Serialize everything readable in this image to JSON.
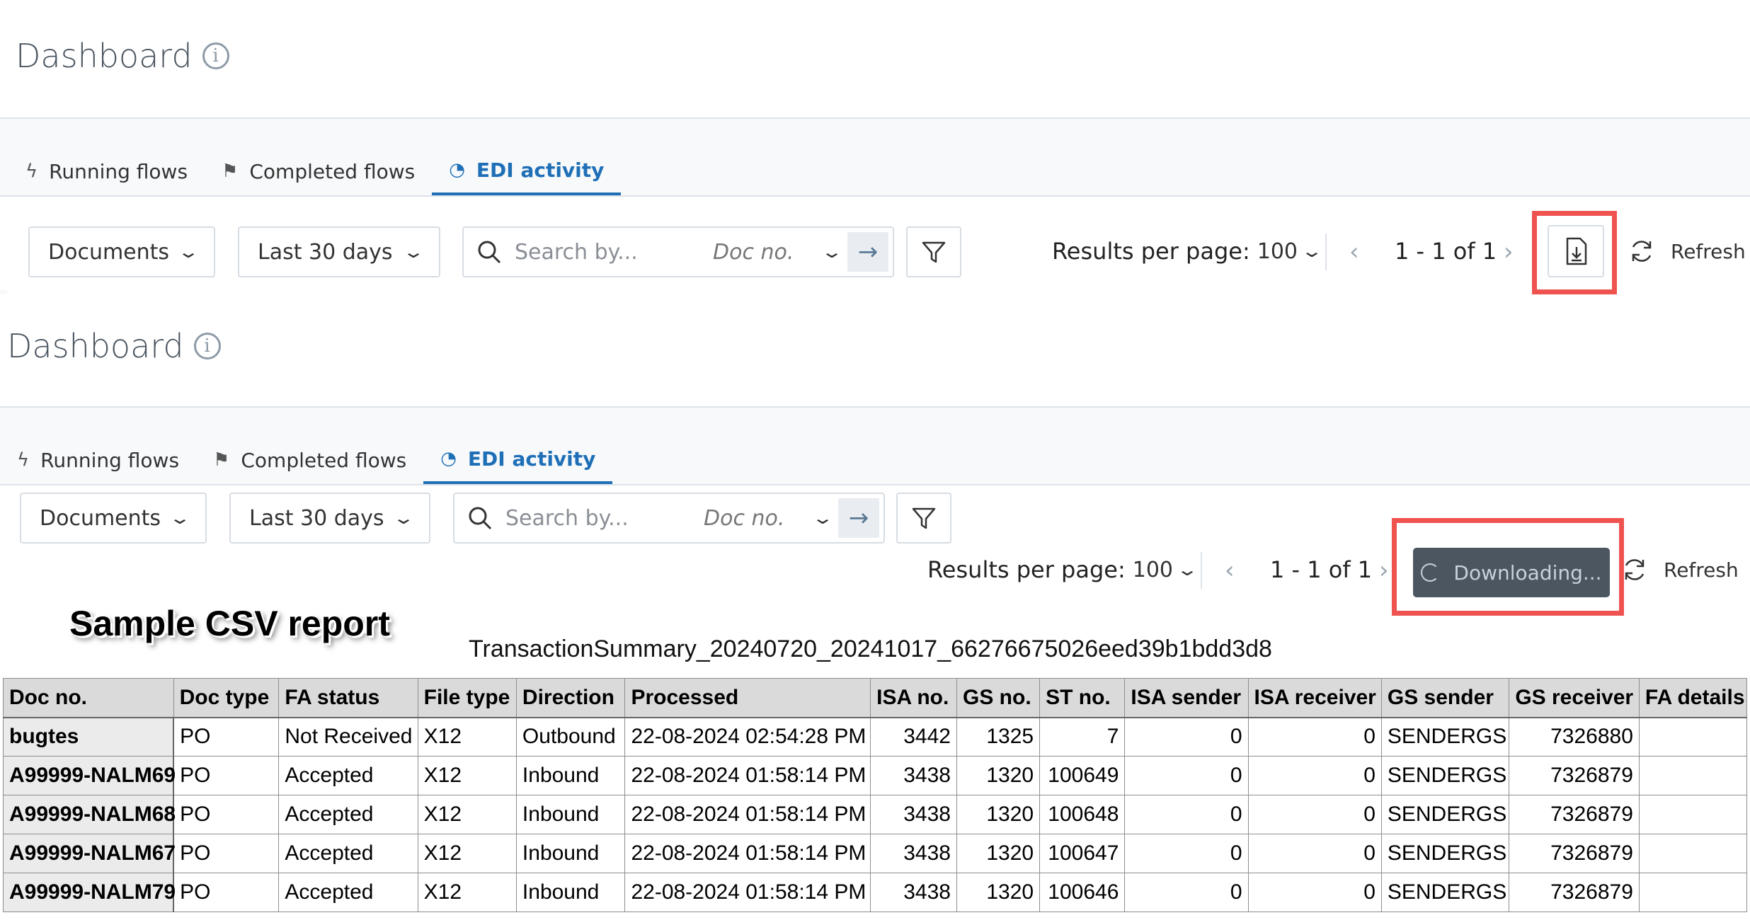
{
  "page": {
    "title": "Dashboard",
    "info_icon": "info-icon"
  },
  "tabs": [
    {
      "label": "Running flows",
      "icon": "bolt-icon"
    },
    {
      "label": "Completed flows",
      "icon": "flag-icon"
    },
    {
      "label": "EDI activity",
      "icon": "clock-icon",
      "active": true
    }
  ],
  "toolbar": {
    "documents_label": "Documents",
    "range_label": "Last 30 days",
    "search_placeholder": "Search by...",
    "search_field": "Doc no.",
    "results_per_page_label": "Results per page:",
    "results_per_page_value": "100",
    "pagination": "1 - 1 of 1",
    "refresh_label": "Refresh",
    "downloading_label": "Downloading..."
  },
  "annotation": {
    "sample_label": "Sample CSV report",
    "report_title": "TransactionSummary_20240720_20241017_66276675026eed39b1bdd3d8"
  },
  "colors": {
    "accent": "#1f6fb7",
    "highlight": "#ef5350",
    "downloading_bg": "#4c5661"
  },
  "report": {
    "columns": [
      "Doc no.",
      "Doc type",
      "FA status",
      "File type",
      "Direction",
      "Processed",
      "ISA no.",
      "GS no.",
      "ST no.",
      "ISA sender",
      "ISA receiver",
      "GS sender",
      "GS receiver",
      "FA details"
    ],
    "rows": [
      [
        "bugtes",
        "PO",
        "Not Received",
        "X12",
        "Outbound",
        "22-08-2024 02:54:28 PM",
        "3442",
        "1325",
        "7",
        "0",
        "0",
        "SENDERGS",
        "7326880",
        ""
      ],
      [
        "A99999-NALM69",
        "PO",
        "Accepted",
        "X12",
        "Inbound",
        "22-08-2024 01:58:14 PM",
        "3438",
        "1320",
        "100649",
        "0",
        "0",
        "SENDERGS",
        "7326879",
        ""
      ],
      [
        "A99999-NALM68",
        "PO",
        "Accepted",
        "X12",
        "Inbound",
        "22-08-2024 01:58:14 PM",
        "3438",
        "1320",
        "100648",
        "0",
        "0",
        "SENDERGS",
        "7326879",
        ""
      ],
      [
        "A99999-NALM67",
        "PO",
        "Accepted",
        "X12",
        "Inbound",
        "22-08-2024 01:58:14 PM",
        "3438",
        "1320",
        "100647",
        "0",
        "0",
        "SENDERGS",
        "7326879",
        ""
      ],
      [
        "A99999-NALM79",
        "PO",
        "Accepted",
        "X12",
        "Inbound",
        "22-08-2024 01:58:14 PM",
        "3438",
        "1320",
        "100646",
        "0",
        "0",
        "SENDERGS",
        "7326879",
        ""
      ]
    ]
  }
}
